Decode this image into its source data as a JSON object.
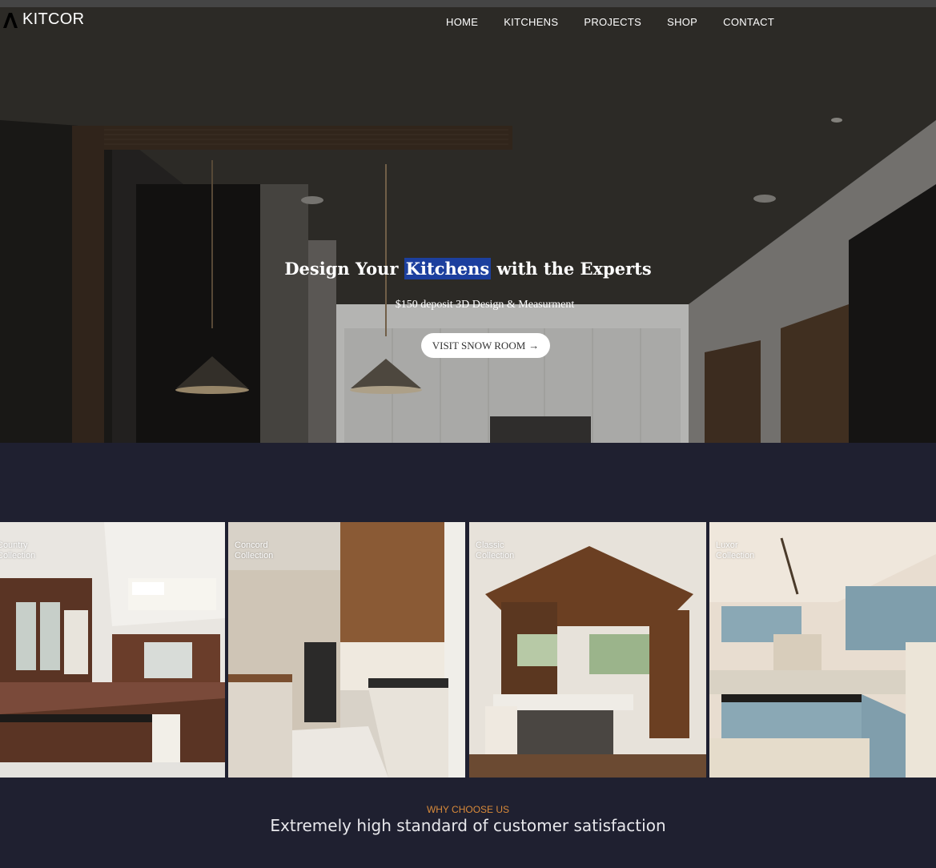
{
  "brand": {
    "name": "KITCOR",
    "logo_icon": "a-letter-logo-icon"
  },
  "nav": {
    "items": [
      "HOME",
      "KITCHENS",
      "PROJECTS",
      "SHOP",
      "CONTACT"
    ]
  },
  "hero": {
    "title_before": "Design Your",
    "title_highlight": "Kitchens",
    "title_after": "with the Experts",
    "subtitle": "$150 deposit 3D Design & Measurment",
    "cta_label": "VISIT SNOW ROOM",
    "cta_icon": "arrow-right-icon",
    "highlight_color": "#1c3f9e"
  },
  "collections": [
    {
      "line1": "Country",
      "line2": "Collection"
    },
    {
      "line1": "Concord",
      "line2": "Collection"
    },
    {
      "line1": "Classic",
      "line2": "Collection"
    },
    {
      "line1": "Luxor",
      "line2": "Collection"
    }
  ],
  "why": {
    "eyebrow": "WHY CHOOSE US",
    "title": "Extremely high standard of customer satisfaction",
    "accent_color": "#d98a3a"
  },
  "colors": {
    "dark_background": "#1f2030"
  }
}
